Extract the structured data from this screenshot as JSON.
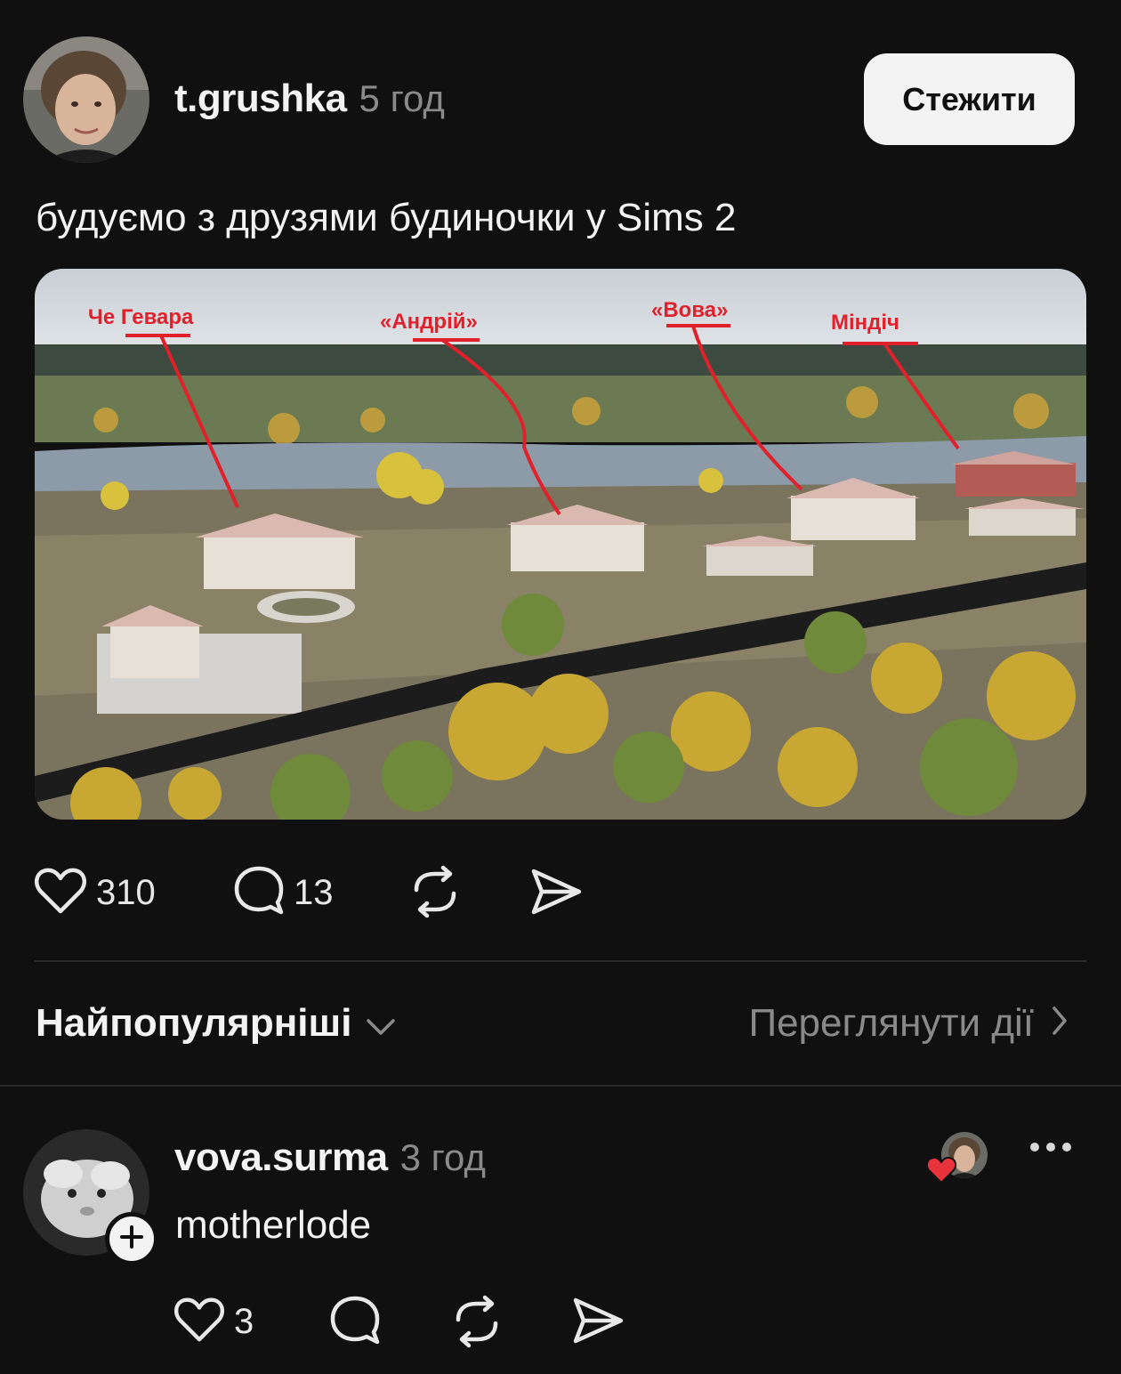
{
  "post": {
    "author": "t.grushka",
    "time": "5 год",
    "follow_label": "Стежити",
    "text": "будуємо з друзями будиночки у Sims 2",
    "image_labels": [
      "Че Гевара",
      "«Андрій»",
      "«Вова»",
      "Міндіч"
    ],
    "likes": "310",
    "comments": "13"
  },
  "sort": {
    "label": "Найпопулярніші",
    "view_activity": "Переглянути дії"
  },
  "comment": {
    "author": "vova.surma",
    "time": "3 год",
    "text": "motherlode",
    "likes": "3"
  },
  "colors": {
    "background": "#101010",
    "text": "#f3f3f3",
    "muted": "#8a8a8a",
    "liked_heart": "#e8323c",
    "annotation": "#e0212b"
  }
}
